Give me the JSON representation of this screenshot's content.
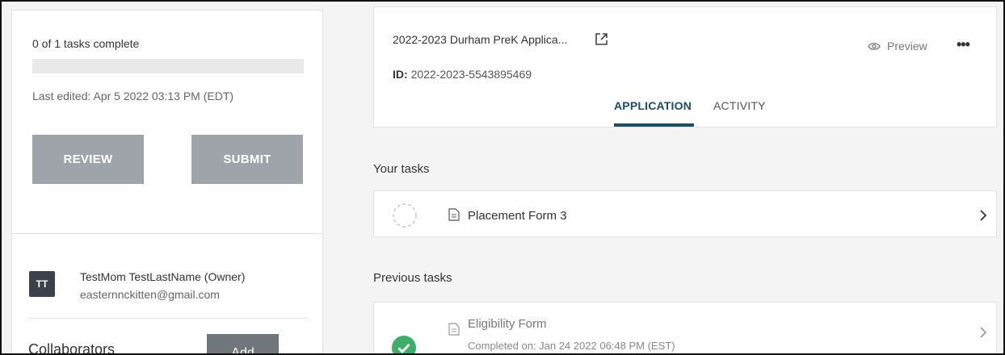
{
  "status": {
    "tasks_complete": "0 of 1 tasks complete",
    "progress_fraction": 0,
    "last_edited": "Last edited: Apr 5 2022 03:13 PM (EDT)"
  },
  "actions": {
    "review_label": "REVIEW",
    "submit_label": "SUBMIT"
  },
  "owner": {
    "initials": "TT",
    "name": "TestMom TestLastName (Owner)",
    "email": "easternnckitten@gmail.com"
  },
  "collaborators": {
    "title": "Collaborators",
    "add_label": "Add"
  },
  "application": {
    "title": "2022-2023 Durham PreK Applica...",
    "id_label": "ID:",
    "id_value": "2022-2023-5543895469",
    "preview_label": "Preview",
    "more_label": "•••",
    "tabs": [
      {
        "label": "APPLICATION",
        "active": true
      },
      {
        "label": "ACTIVITY",
        "active": false
      }
    ]
  },
  "your_tasks": {
    "title": "Your tasks",
    "items": [
      {
        "name": "Placement Form 3"
      }
    ]
  },
  "previous_tasks": {
    "title": "Previous tasks",
    "items": [
      {
        "name": "Eligibility Form",
        "meta": "Completed on: Jan 24 2022 06:48 PM (EST)"
      }
    ]
  },
  "colors": {
    "accent": "#1b4d6e",
    "button_disabled": "#9ea4aa",
    "success": "#3cae6a",
    "avatar_bg": "#3a4148"
  },
  "icons": {
    "external": "external-link-icon",
    "preview": "eye-icon",
    "more": "more-horizontal-icon",
    "document": "document-icon",
    "pending": "pending-circle-icon",
    "completed": "check-circle-icon",
    "chevron": "chevron-right-icon"
  }
}
